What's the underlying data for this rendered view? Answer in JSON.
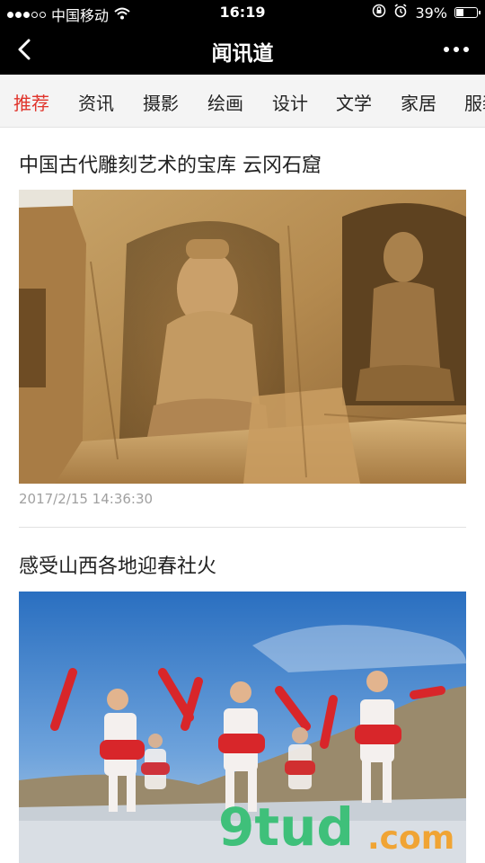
{
  "status_bar": {
    "carrier": "中国移动",
    "time": "16:19",
    "battery": "39%",
    "battery_level": 0.39,
    "icons": [
      "signal-dots",
      "wifi-icon",
      "rotation-lock-icon",
      "alarm-icon",
      "battery-icon"
    ]
  },
  "nav": {
    "title": "闻讯道",
    "back_icon": "back-arrow-icon",
    "more_icon": "more-icon"
  },
  "tabs": [
    {
      "label": "推荐",
      "active": true
    },
    {
      "label": "资讯",
      "active": false
    },
    {
      "label": "摄影",
      "active": false
    },
    {
      "label": "绘画",
      "active": false
    },
    {
      "label": "设计",
      "active": false
    },
    {
      "label": "文学",
      "active": false
    },
    {
      "label": "家居",
      "active": false
    },
    {
      "label": "服装",
      "active": false
    }
  ],
  "articles": [
    {
      "title": "中国古代雕刻艺术的宝库 云冈石窟",
      "timestamp": "2017/2/15 14:36:30",
      "image": "buddha-cave-statues"
    },
    {
      "title": "感受山西各地迎春社火",
      "image": "drum-dancers-red-ribbons"
    }
  ],
  "watermark": {
    "main": "9tud",
    "suffix": ".com"
  },
  "colors": {
    "accent": "#e0342b",
    "bar_bg": "#000000",
    "tab_bg": "#f4f4f4",
    "timestamp": "#a0a0a0"
  }
}
